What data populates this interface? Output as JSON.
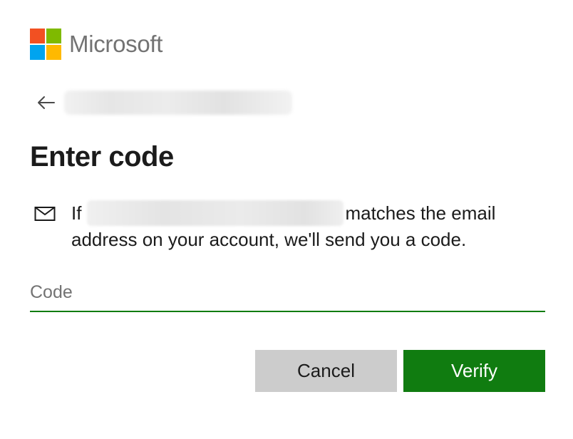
{
  "brand": {
    "name": "Microsoft",
    "logo_colors": [
      "#f25022",
      "#7fba00",
      "#00a4ef",
      "#ffb900"
    ]
  },
  "identity": {
    "back_icon": "back-arrow-icon",
    "email": ""
  },
  "title": "Enter code",
  "message": {
    "icon": "mail-icon",
    "prefix": "If",
    "email": "",
    "suffix": "matches the email address on your account, we'll send you a code."
  },
  "code_field": {
    "value": "",
    "placeholder": "Code"
  },
  "buttons": {
    "cancel_label": "Cancel",
    "verify_label": "Verify"
  },
  "colors": {
    "accent": "#107c10",
    "cancel_bg": "#cccccc",
    "logo_text": "#737373"
  }
}
